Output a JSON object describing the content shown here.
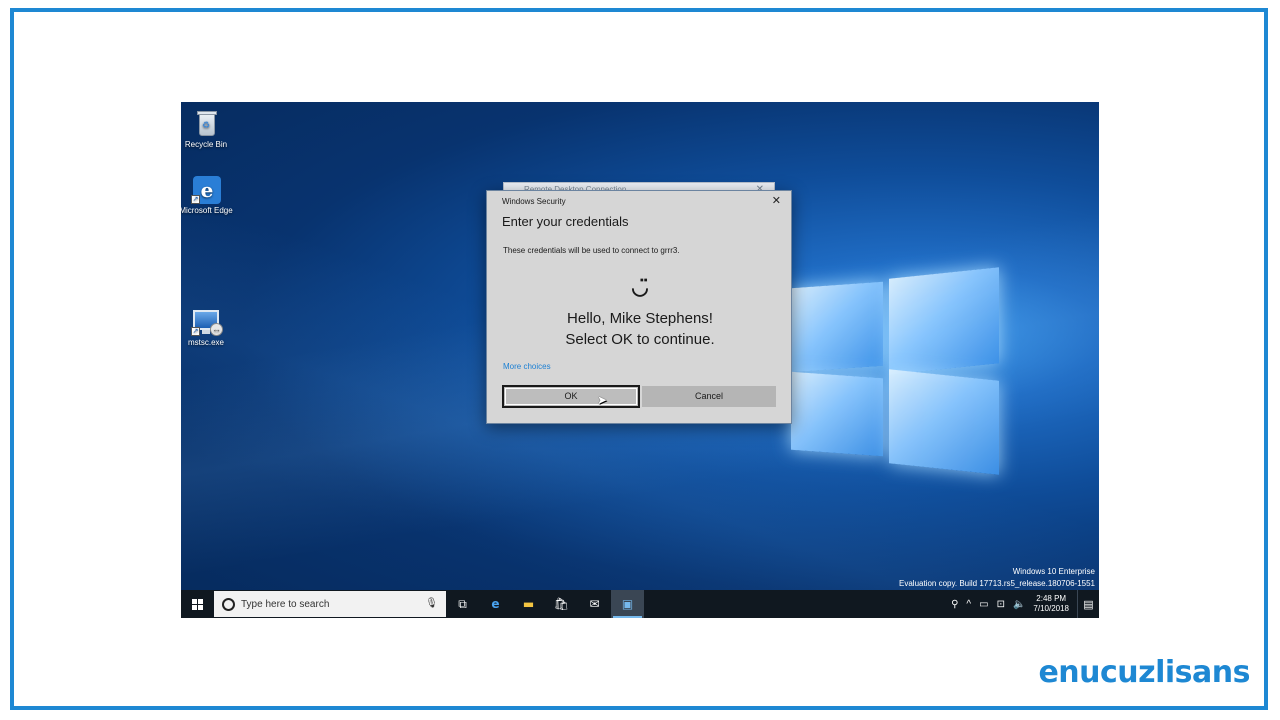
{
  "brand": {
    "name": "enucuzlisans"
  },
  "desktop": {
    "icons": [
      {
        "label": "Recycle Bin",
        "icon": "recycle-bin-icon"
      },
      {
        "label": "Microsoft Edge",
        "icon": "edge-icon"
      },
      {
        "label": "mstsc.exe",
        "icon": "remote-desktop-icon"
      }
    ],
    "watermark": {
      "line1": "Windows 10 Enterprise",
      "line2": "Evaluation copy. Build 17713.rs5_release.180706-1551"
    }
  },
  "background_window": {
    "title": "Remote Desktop Connection"
  },
  "dialog": {
    "window_title": "Windows Security",
    "heading": "Enter your credentials",
    "description": "These credentials will be used to connect to grrr3.",
    "smiley": "◡̈",
    "greeting_line1": "Hello, Mike Stephens!",
    "greeting_line2": "Select OK to continue.",
    "more_choices": "More choices",
    "ok_label": "OK",
    "cancel_label": "Cancel",
    "close_glyph": "✕"
  },
  "taskbar": {
    "search_placeholder": "Type here to search",
    "clock_time": "2:48 PM",
    "clock_date": "7/10/2018"
  },
  "colors": {
    "frame_border": "#1e88d3",
    "brand": "#1e88d3",
    "link": "#1b7fd3",
    "taskbar": "#101820"
  }
}
